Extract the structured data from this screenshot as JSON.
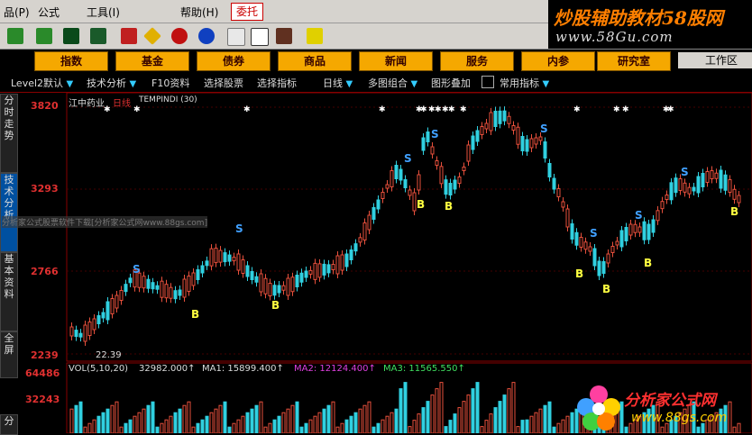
{
  "menubar": {
    "items": [
      "品(P)",
      "公式",
      "工具(I)",
      "帮助(H)"
    ],
    "entrust": "委托"
  },
  "banner": {
    "title": "炒股辅助教材58股网",
    "url": "www.58Gu.com"
  },
  "categories": [
    "指数",
    "基金",
    "债券",
    "商品",
    "新闻",
    "服务",
    "内参",
    "研究室"
  ],
  "workarea": "工作区",
  "tabs": [
    {
      "label": "Level2默认",
      "dropdown": true
    },
    {
      "label": "技术分析",
      "dropdown": true
    },
    {
      "label": "F10资料",
      "dropdown": false
    },
    {
      "label": "选择股票",
      "dropdown": false
    },
    {
      "label": "选择指标",
      "dropdown": false
    },
    {
      "label": "日线",
      "dropdown": true
    },
    {
      "label": "多图组合",
      "dropdown": true
    },
    {
      "label": "图形叠加",
      "dropdown": false
    },
    {
      "label": "常用指标",
      "dropdown": true
    }
  ],
  "side_tabs": [
    "分时走势",
    "技术分析",
    "基本资料",
    "全屏",
    "分"
  ],
  "chart": {
    "stock": "江中药业",
    "period": "日线",
    "indicator": "TEMPINDI (30)",
    "y_labels": [
      "3820",
      "3293",
      "2766",
      "2239"
    ],
    "low_marker": "22.39",
    "overlay_text": "分析家公式股票软件下载[分析家公式网www.88gs.com]"
  },
  "volume": {
    "label": "VOL(5,10,20)",
    "value": "32982.000↑",
    "ma1": "MA1: 15899.400↑",
    "ma2": "MA2: 12124.400↑",
    "ma3": "MA3: 11565.550↑",
    "y_labels": [
      "64486",
      "32243"
    ]
  },
  "watermark": {
    "title": "分析家公式网",
    "url": "www.88gs.com"
  },
  "chart_data": {
    "type": "candlestick",
    "y_ticks": [
      2239,
      2766,
      3293,
      3820
    ],
    "signals": [
      "S",
      "B"
    ],
    "colors": {
      "up": "#e8503c",
      "down": "#30d0e0",
      "buy": "#ffff40",
      "sell": "#40a0ff"
    }
  }
}
